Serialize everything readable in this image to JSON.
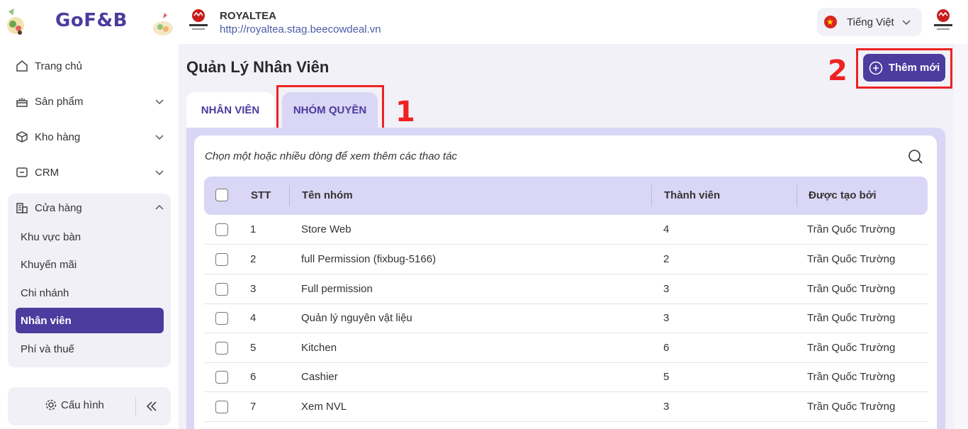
{
  "brand": {
    "name": "GoF&B"
  },
  "sidebar": {
    "items": [
      {
        "label": "Trang chủ"
      },
      {
        "label": "Sản phẩm"
      },
      {
        "label": "Kho hàng"
      },
      {
        "label": "CRM"
      },
      {
        "label": "Cửa hàng"
      }
    ],
    "store_sub": [
      {
        "label": "Khu vực bàn"
      },
      {
        "label": "Khuyến mãi"
      },
      {
        "label": "Chi nhánh"
      },
      {
        "label": "Nhân viên"
      },
      {
        "label": "Phí và thuế"
      }
    ],
    "config_label": "Cấu hình"
  },
  "header": {
    "store_name": "ROYALTEA",
    "store_url": "http://royaltea.stag.beecowdeal.vn",
    "language": "Tiếng Việt"
  },
  "page": {
    "title": "Quản Lý Nhân Viên",
    "add_label": "Thêm mới",
    "tabs": [
      {
        "label": "NHÂN VIÊN"
      },
      {
        "label": "NHÓM QUYỀN"
      }
    ],
    "annotations": {
      "one": "1",
      "two": "2"
    },
    "hint": "Chọn một hoặc nhiều dòng để xem thêm các thao tác"
  },
  "table": {
    "columns": [
      "STT",
      "Tên nhóm",
      "Thành viên",
      "Được tạo bởi"
    ],
    "rows": [
      {
        "stt": "1",
        "name": "Store Web",
        "members": "4",
        "creator": "Trần Quốc Trường"
      },
      {
        "stt": "2",
        "name": "full Permission (fixbug-5166)",
        "members": "2",
        "creator": "Trần Quốc Trường"
      },
      {
        "stt": "3",
        "name": "Full permission",
        "members": "3",
        "creator": "Trần Quốc Trường"
      },
      {
        "stt": "4",
        "name": "Quản lý nguyên vật liệu",
        "members": "3",
        "creator": "Trần Quốc Trường"
      },
      {
        "stt": "5",
        "name": "Kitchen",
        "members": "6",
        "creator": "Trần Quốc Trường"
      },
      {
        "stt": "6",
        "name": "Cashier",
        "members": "5",
        "creator": "Trần Quốc Trường"
      },
      {
        "stt": "7",
        "name": "Xem NVL",
        "members": "3",
        "creator": "Trần Quốc Trường"
      }
    ]
  },
  "colors": {
    "primary": "#4b3c9e",
    "highlight": "#ee2222",
    "tab_active_bg": "#dad6f5"
  }
}
